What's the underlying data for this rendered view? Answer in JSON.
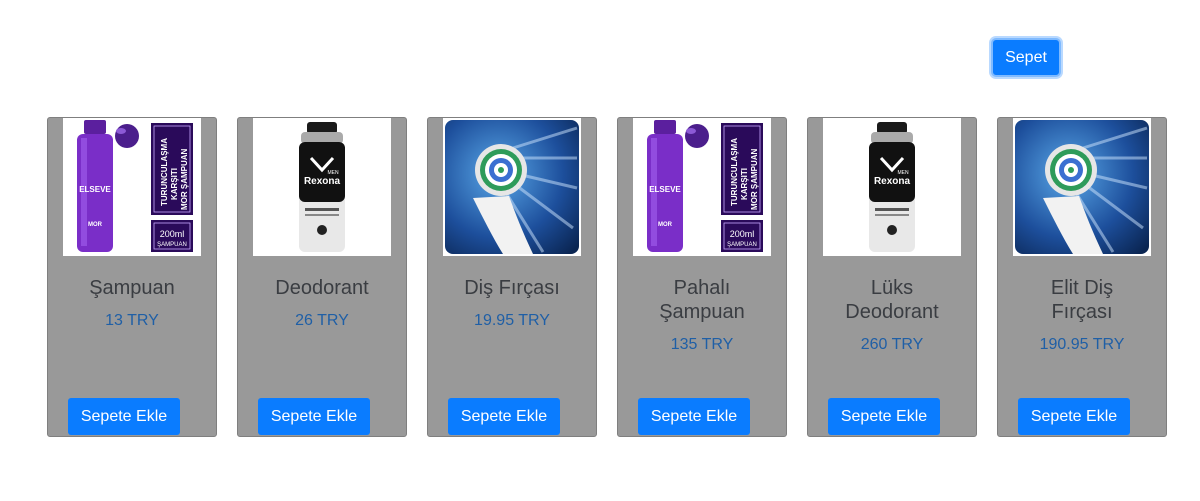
{
  "header": {
    "cart_label": "Sepet"
  },
  "products": [
    {
      "name": "Şampuan",
      "price": "13 TRY",
      "button": "Sepete Ekle",
      "image": "shampoo-image",
      "image_text": [
        "ELSEVE",
        "TURUNCULAŞMA KARŞITI",
        "MOR ŞAMPUAN",
        "200ml",
        "ŞAMPUAN"
      ]
    },
    {
      "name": "Deodorant",
      "price": "26 TRY",
      "button": "Sepete Ekle",
      "image": "deodorant-image",
      "image_text": [
        "Rexona",
        "MEN"
      ]
    },
    {
      "name": "Diş Fırçası",
      "price": "19.95 TRY",
      "button": "Sepete Ekle",
      "image": "toothbrush-head-image"
    },
    {
      "name": "Pahalı Şampuan",
      "price": "135 TRY",
      "button": "Sepete Ekle",
      "image": "shampoo-image",
      "image_text": [
        "ELSEVE",
        "TURUNCULAŞMA KARŞITI",
        "MOR ŞAMPUAN",
        "200ml",
        "ŞAMPUAN"
      ]
    },
    {
      "name": "Lüks Deodorant",
      "price": "260 TRY",
      "button": "Sepete Ekle",
      "image": "deodorant-image",
      "image_text": [
        "Rexona",
        "MEN"
      ]
    },
    {
      "name": "Elit Diş Fırçası",
      "price": "190.95 TRY",
      "button": "Sepete Ekle",
      "image": "toothbrush-head-image"
    }
  ],
  "colors": {
    "primary_button": "#0a7cff",
    "card_background": "#999999",
    "price_text": "#1f5fa6",
    "name_text": "#3a3d42"
  }
}
